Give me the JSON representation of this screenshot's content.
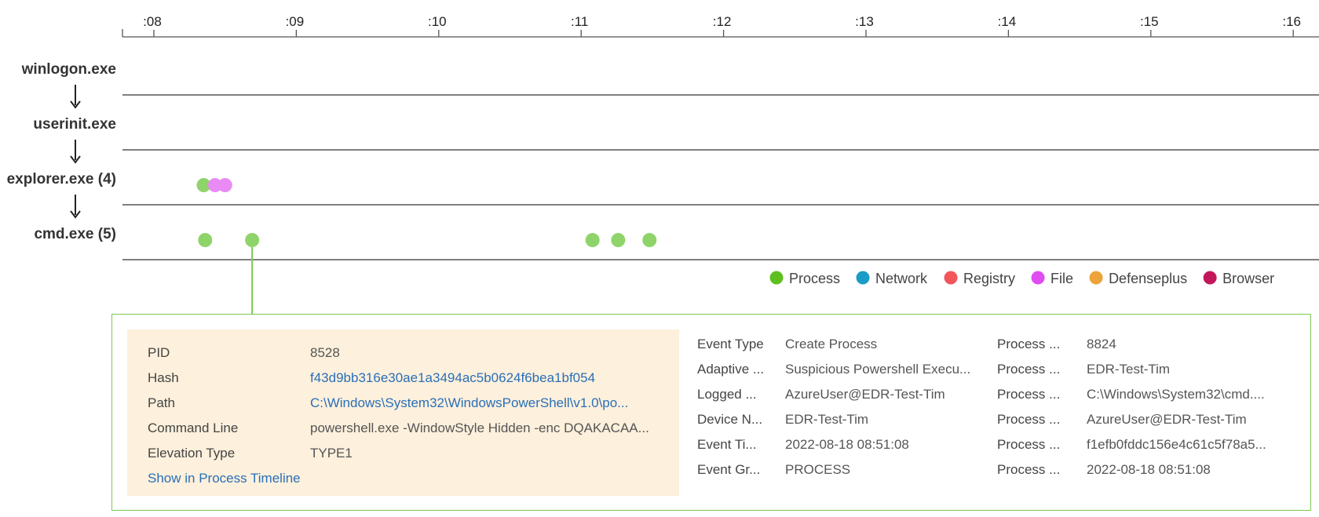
{
  "timeline": {
    "ticks": [
      ":08",
      ":09",
      ":10",
      ":11",
      ":12",
      ":13",
      ":14",
      ":15",
      ":16"
    ],
    "processes": [
      {
        "label": "winlogon.exe"
      },
      {
        "label": "userinit.exe"
      },
      {
        "label": "explorer.exe (4)"
      },
      {
        "label": "cmd.exe (5)"
      }
    ],
    "events": [
      {
        "row": 2,
        "t": 8.35,
        "type": "process"
      },
      {
        "row": 2,
        "t": 8.43,
        "type": "file"
      },
      {
        "row": 2,
        "t": 8.5,
        "type": "file"
      },
      {
        "row": 3,
        "t": 8.36,
        "type": "process"
      },
      {
        "row": 3,
        "t": 8.69,
        "type": "process",
        "selected": true
      },
      {
        "row": 3,
        "t": 11.08,
        "type": "process"
      },
      {
        "row": 3,
        "t": 11.26,
        "type": "process"
      },
      {
        "row": 3,
        "t": 11.48,
        "type": "process"
      }
    ],
    "legend": [
      {
        "key": "process",
        "label": "Process",
        "color": "#5dc01f"
      },
      {
        "key": "network",
        "label": "Network",
        "color": "#1b9cc6"
      },
      {
        "key": "registry",
        "label": "Registry",
        "color": "#f2555a"
      },
      {
        "key": "file",
        "label": "File",
        "color": "#df4cf0"
      },
      {
        "key": "defenseplus",
        "label": "Defenseplus",
        "color": "#eba33a"
      },
      {
        "key": "browser",
        "label": "Browser",
        "color": "#c2185b"
      }
    ],
    "event_colors": {
      "process": "#8fd46a",
      "file": "#e98af5"
    }
  },
  "details": {
    "left": {
      "pid_label": "PID",
      "pid_value": "8528",
      "hash_label": "Hash",
      "hash_value": "f43d9bb316e30ae1a3494ac5b0624f6bea1bf054",
      "path_label": "Path",
      "path_value": "C:\\Windows\\System32\\WindowsPowerShell\\v1.0\\po...",
      "cmd_label": "Command Line",
      "cmd_value": "powershell.exe -WindowStyle Hidden -enc DQAKACAA...",
      "elev_label": "Elevation Type",
      "elev_value": "TYPE1",
      "show_link": "Show in Process Timeline"
    },
    "middle": [
      {
        "key": "Event Type",
        "value": "Create Process"
      },
      {
        "key": "Adaptive ...",
        "value": "Suspicious Powershell Execu..."
      },
      {
        "key": "Logged ...",
        "value": "AzureUser@EDR-Test-Tim"
      },
      {
        "key": "Device N...",
        "value": "EDR-Test-Tim"
      },
      {
        "key": "Event Ti...",
        "value": "2022-08-18 08:51:08"
      },
      {
        "key": "Event Gr...",
        "value": "PROCESS"
      }
    ],
    "right": [
      {
        "key": "Process ...",
        "value": "8824"
      },
      {
        "key": "Process ...",
        "value": "EDR-Test-Tim"
      },
      {
        "key": "Process ...",
        "value": "C:\\Windows\\System32\\cmd...."
      },
      {
        "key": "Process ...",
        "value": "AzureUser@EDR-Test-Tim"
      },
      {
        "key": "Process ...",
        "value": "f1efb0fddc156e4c61c5f78a5..."
      },
      {
        "key": "Process ...",
        "value": "2022-08-18 08:51:08"
      }
    ]
  }
}
